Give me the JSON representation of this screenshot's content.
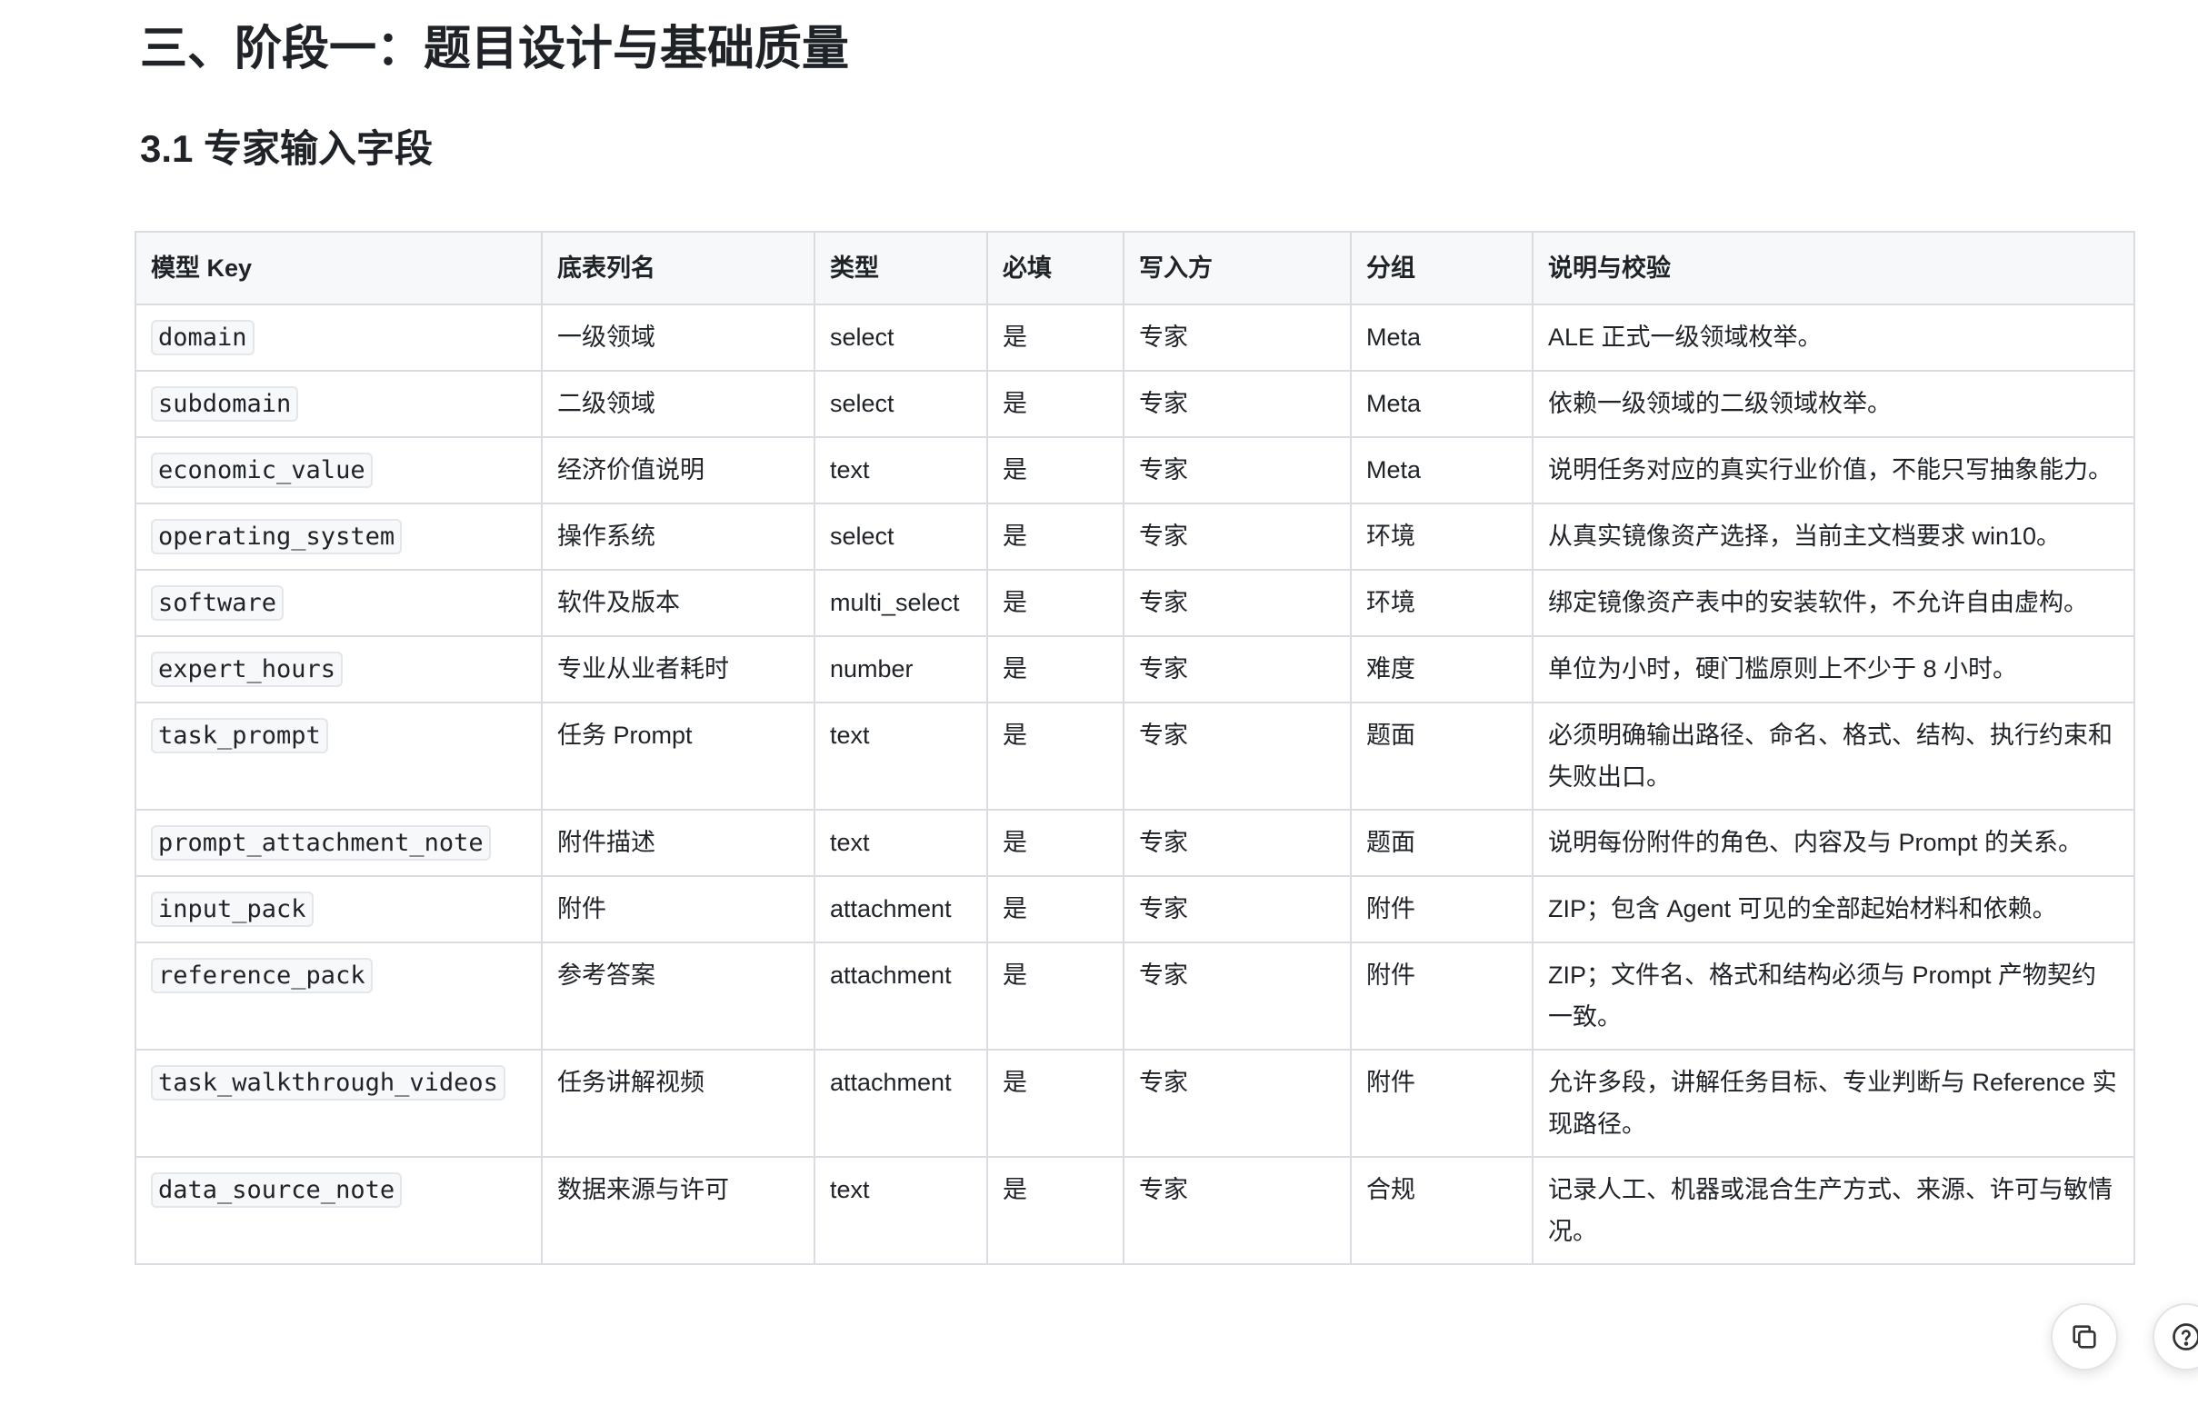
{
  "headings": {
    "section": "三、阶段一：题目设计与基础质量",
    "subsection": "3.1 专家输入字段"
  },
  "table": {
    "headers": [
      "模型 Key",
      "底表列名",
      "类型",
      "必填",
      "写入方",
      "分组",
      "说明与校验"
    ],
    "rows": [
      {
        "key": "domain",
        "column": "一级领域",
        "type": "select",
        "required": "是",
        "writer": "专家",
        "group": "Meta",
        "desc": "ALE 正式一级领域枚举。"
      },
      {
        "key": "subdomain",
        "column": "二级领域",
        "type": "select",
        "required": "是",
        "writer": "专家",
        "group": "Meta",
        "desc": "依赖一级领域的二级领域枚举。"
      },
      {
        "key": "economic_value",
        "column": "经济价值说明",
        "type": "text",
        "required": "是",
        "writer": "专家",
        "group": "Meta",
        "desc": "说明任务对应的真实行业价值，不能只写抽象能力。"
      },
      {
        "key": "operating_system",
        "column": "操作系统",
        "type": "select",
        "required": "是",
        "writer": "专家",
        "group": "环境",
        "desc": "从真实镜像资产选择，当前主文档要求 win10。"
      },
      {
        "key": "software",
        "column": "软件及版本",
        "type": "multi_select",
        "required": "是",
        "writer": "专家",
        "group": "环境",
        "desc": "绑定镜像资产表中的安装软件，不允许自由虚构。"
      },
      {
        "key": "expert_hours",
        "column": "专业从业者耗时",
        "type": "number",
        "required": "是",
        "writer": "专家",
        "group": "难度",
        "desc": "单位为小时，硬门槛原则上不少于 8 小时。"
      },
      {
        "key": "task_prompt",
        "column": "任务 Prompt",
        "type": "text",
        "required": "是",
        "writer": "专家",
        "group": "题面",
        "desc": "必须明确输出路径、命名、格式、结构、执行约束和失败出口。"
      },
      {
        "key": "prompt_attachment_note",
        "column": "附件描述",
        "type": "text",
        "required": "是",
        "writer": "专家",
        "group": "题面",
        "desc": "说明每份附件的角色、内容及与 Prompt 的关系。"
      },
      {
        "key": "input_pack",
        "column": "附件",
        "type": "attachment",
        "required": "是",
        "writer": "专家",
        "group": "附件",
        "desc": "ZIP；包含 Agent 可见的全部起始材料和依赖。"
      },
      {
        "key": "reference_pack",
        "column": "参考答案",
        "type": "attachment",
        "required": "是",
        "writer": "专家",
        "group": "附件",
        "desc": "ZIP；文件名、格式和结构必须与 Prompt 产物契约一致。"
      },
      {
        "key": "task_walkthrough_videos",
        "column": "任务讲解视频",
        "type": "attachment",
        "required": "是",
        "writer": "专家",
        "group": "附件",
        "desc": "允许多段，讲解任务目标、专业判断与 Reference 实现路径。"
      },
      {
        "key": "data_source_note",
        "column": "数据来源与许可",
        "type": "text",
        "required": "是",
        "writer": "专家",
        "group": "合规",
        "desc": "记录人工、机器或混合生产方式、来源、许可与敏情况。"
      }
    ]
  },
  "icons": {
    "copy": "copy-icon",
    "help": "help-icon"
  }
}
